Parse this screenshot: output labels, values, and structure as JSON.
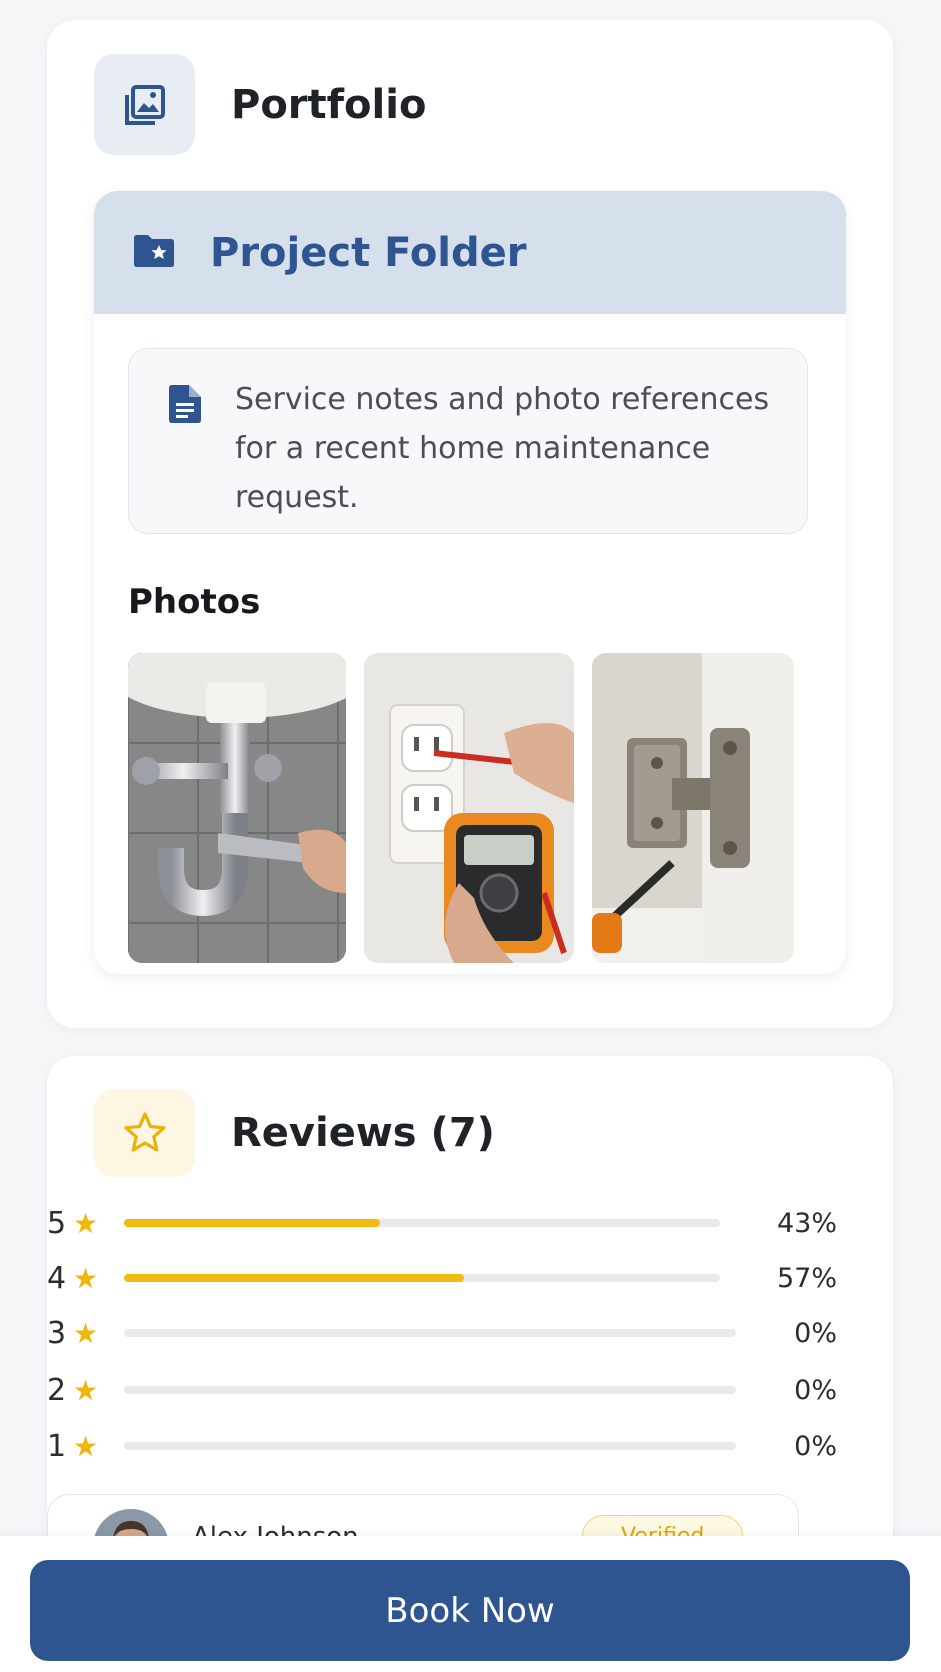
{
  "portfolio": {
    "title": "Portfolio",
    "icon": "gallery-icon",
    "folder": {
      "title": "Project Folder",
      "icon": "folder-star-icon",
      "notes_icon": "document-icon",
      "notes": "Service notes and photo references for a recent home maintenance request.",
      "photos_label": "Photos",
      "photos": [
        {
          "subject": "plumbing-pipe-wrench"
        },
        {
          "subject": "outlet-multimeter-test"
        },
        {
          "subject": "cabinet-hinge-screwdriver"
        }
      ]
    }
  },
  "reviews": {
    "title": "Reviews (7)",
    "icon": "star-outline-icon",
    "distribution": [
      {
        "stars": "5",
        "percent_label": "43%",
        "fill": 0.43
      },
      {
        "stars": "4",
        "percent_label": "57%",
        "fill": 0.57
      },
      {
        "stars": "3",
        "percent_label": "0%",
        "fill": 0
      },
      {
        "stars": "2",
        "percent_label": "0%",
        "fill": 0
      },
      {
        "stars": "1",
        "percent_label": "0%",
        "fill": 0
      }
    ],
    "first_review": {
      "name": "Alex Johnson",
      "badge": "Verified"
    }
  },
  "actions": {
    "book_label": "Book Now"
  },
  "colors": {
    "primary": "#2f5590",
    "star": "#f2b705",
    "folder_header": "#d6e0ec"
  }
}
